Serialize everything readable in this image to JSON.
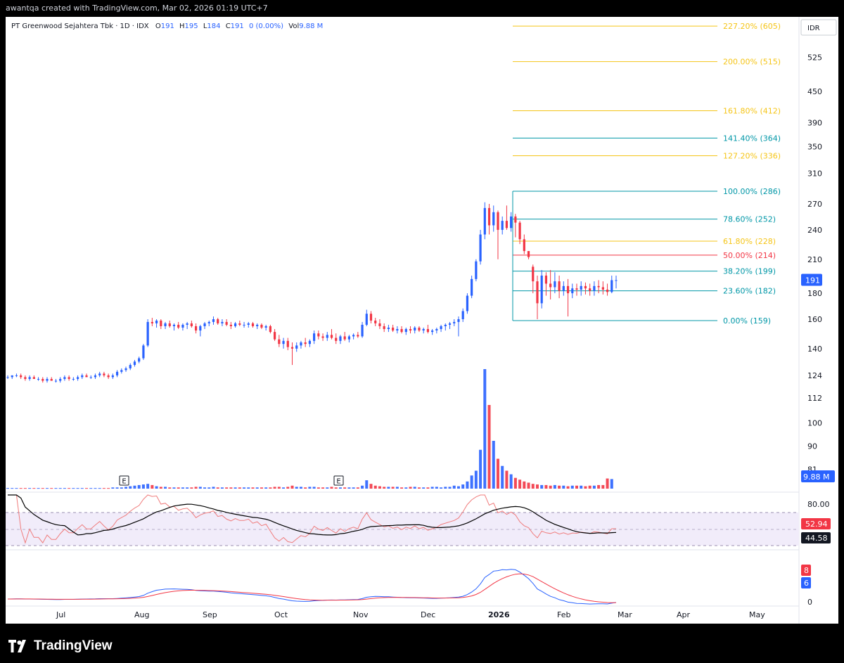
{
  "header": {
    "attribution": "awantqa created with TradingView.com, Mar 02, 2026 01:19 UTC+7"
  },
  "legend": {
    "symbol": "PT Greenwood Sejahtera Tbk · 1D · IDX",
    "open_label": "O",
    "open": "191",
    "high_label": "H",
    "high": "195",
    "low_label": "L",
    "low": "184",
    "close_label": "C",
    "close": "191",
    "change": "0 (0.00%)",
    "vol_label": "Vol",
    "vol": "9.88 M"
  },
  "footer": {
    "brand": "TradingView"
  },
  "colors": {
    "up": "#2962ff",
    "down": "#f23645",
    "fib_teal": "#26a69a",
    "fib_blue": "#0097a7",
    "fib_yellow": "#f5c518",
    "fib_red": "#f23645",
    "rsi": "#f07c7c",
    "rsi_ma": "#000000",
    "rsi_band": "#e9e0f7",
    "macd_blue": "#2962ff",
    "macd_red": "#f23645"
  },
  "chart_data": {
    "type": "candlestick",
    "title": "PT Greenwood Sejahtera Tbk · 1D · IDX",
    "currency": "IDR",
    "price_scale": "log",
    "price_axis_ticks": [
      "525",
      "450",
      "390",
      "350",
      "310",
      "270",
      "240",
      "210",
      "180",
      "160",
      "140",
      "124",
      "112",
      "100",
      "90",
      "81"
    ],
    "time_axis_ticks": [
      "Jul",
      "Aug",
      "Sep",
      "Oct",
      "Nov",
      "Dec",
      "2026",
      "Feb",
      "Mar",
      "Apr",
      "May"
    ],
    "last_price": "191",
    "last_volume": "9.88 M",
    "earnings_markers": [
      "E",
      "E"
    ],
    "fibonacci": [
      {
        "label": "227.20% (605)",
        "price": 605,
        "color": "#f5c518"
      },
      {
        "label": "200.00% (515)",
        "price": 515,
        "color": "#f5c518"
      },
      {
        "label": "161.80% (412)",
        "price": 412,
        "color": "#f5c518"
      },
      {
        "label": "141.40% (364)",
        "price": 364,
        "color": "#0097a7"
      },
      {
        "label": "127.20% (336)",
        "price": 336,
        "color": "#f5c518"
      },
      {
        "label": "100.00% (286)",
        "price": 286,
        "color": "#0097a7"
      },
      {
        "label": "78.60% (252)",
        "price": 252,
        "color": "#0097a7"
      },
      {
        "label": "61.80% (228)",
        "price": 228,
        "color": "#f5c518"
      },
      {
        "label": "50.00% (214)",
        "price": 214,
        "color": "#f23645"
      },
      {
        "label": "38.20% (199)",
        "price": 199,
        "color": "#0097a7"
      },
      {
        "label": "23.60% (182)",
        "price": 182,
        "color": "#0097a7"
      },
      {
        "label": "0.00% (159)",
        "price": 159,
        "color": "#0097a7"
      }
    ],
    "candles": [
      [
        123,
        124,
        122,
        123
      ],
      [
        123,
        124,
        122,
        124
      ],
      [
        124,
        125,
        123,
        124
      ],
      [
        124,
        125,
        122,
        123
      ],
      [
        123,
        124,
        121,
        122
      ],
      [
        122,
        124,
        121,
        123
      ],
      [
        123,
        124,
        122,
        122
      ],
      [
        122,
        123,
        121,
        122
      ],
      [
        122,
        123,
        120,
        121
      ],
      [
        121,
        123,
        120,
        122
      ],
      [
        122,
        123,
        121,
        121
      ],
      [
        121,
        122,
        120,
        121
      ],
      [
        121,
        123,
        120,
        122
      ],
      [
        122,
        124,
        121,
        123
      ],
      [
        123,
        124,
        121,
        122
      ],
      [
        122,
        123,
        121,
        122
      ],
      [
        122,
        124,
        121,
        123
      ],
      [
        123,
        125,
        122,
        124
      ],
      [
        124,
        125,
        123,
        123
      ],
      [
        123,
        124,
        122,
        123
      ],
      [
        123,
        125,
        122,
        124
      ],
      [
        124,
        126,
        123,
        125
      ],
      [
        125,
        126,
        123,
        124
      ],
      [
        124,
        125,
        122,
        123
      ],
      [
        123,
        125,
        122,
        124
      ],
      [
        124,
        127,
        123,
        126
      ],
      [
        126,
        128,
        125,
        127
      ],
      [
        127,
        129,
        126,
        128
      ],
      [
        128,
        131,
        127,
        130
      ],
      [
        130,
        133,
        129,
        132
      ],
      [
        132,
        135,
        131,
        134
      ],
      [
        134,
        143,
        133,
        142
      ],
      [
        142,
        160,
        141,
        158
      ],
      [
        158,
        161,
        155,
        157
      ],
      [
        157,
        160,
        154,
        159
      ],
      [
        159,
        160,
        153,
        155
      ],
      [
        155,
        158,
        153,
        157
      ],
      [
        157,
        159,
        154,
        155
      ],
      [
        155,
        157,
        152,
        156
      ],
      [
        156,
        158,
        153,
        154
      ],
      [
        154,
        157,
        152,
        156
      ],
      [
        156,
        158,
        153,
        157
      ],
      [
        157,
        159,
        154,
        155
      ],
      [
        155,
        157,
        150,
        152
      ],
      [
        152,
        156,
        148,
        155
      ],
      [
        155,
        158,
        153,
        157
      ],
      [
        157,
        159,
        155,
        158
      ],
      [
        158,
        162,
        156,
        160
      ],
      [
        160,
        161,
        156,
        157
      ],
      [
        157,
        160,
        155,
        158
      ],
      [
        158,
        160,
        155,
        156
      ],
      [
        156,
        158,
        153,
        155
      ],
      [
        155,
        158,
        154,
        157
      ],
      [
        157,
        159,
        155,
        156
      ],
      [
        156,
        158,
        154,
        156
      ],
      [
        156,
        158,
        154,
        157
      ],
      [
        157,
        158,
        154,
        155
      ],
      [
        155,
        157,
        153,
        156
      ],
      [
        156,
        157,
        153,
        154
      ],
      [
        154,
        156,
        152,
        155
      ],
      [
        155,
        156,
        150,
        151
      ],
      [
        151,
        153,
        145,
        146
      ],
      [
        146,
        149,
        141,
        143
      ],
      [
        143,
        147,
        140,
        145
      ],
      [
        145,
        147,
        139,
        141
      ],
      [
        141,
        144,
        130,
        140
      ],
      [
        140,
        144,
        138,
        142
      ],
      [
        142,
        145,
        140,
        144
      ],
      [
        144,
        147,
        141,
        143
      ],
      [
        143,
        146,
        141,
        145
      ],
      [
        145,
        152,
        143,
        150
      ],
      [
        150,
        152,
        146,
        148
      ],
      [
        148,
        150,
        145,
        147
      ],
      [
        147,
        151,
        145,
        149
      ],
      [
        149,
        153,
        146,
        147
      ],
      [
        147,
        150,
        143,
        145
      ],
      [
        145,
        149,
        143,
        148
      ],
      [
        148,
        151,
        145,
        146
      ],
      [
        146,
        149,
        144,
        148
      ],
      [
        148,
        150,
        146,
        149
      ],
      [
        149,
        151,
        147,
        148
      ],
      [
        148,
        158,
        147,
        156
      ],
      [
        156,
        167,
        155,
        164
      ],
      [
        164,
        166,
        157,
        159
      ],
      [
        159,
        161,
        155,
        157
      ],
      [
        157,
        160,
        153,
        155
      ],
      [
        155,
        157,
        151,
        153
      ],
      [
        153,
        156,
        151,
        154
      ],
      [
        154,
        156,
        151,
        152
      ],
      [
        152,
        155,
        150,
        153
      ],
      [
        153,
        155,
        150,
        151
      ],
      [
        151,
        154,
        149,
        153
      ],
      [
        153,
        155,
        150,
        152
      ],
      [
        152,
        155,
        150,
        154
      ],
      [
        154,
        155,
        151,
        152
      ],
      [
        152,
        154,
        150,
        153
      ],
      [
        153,
        156,
        150,
        151
      ],
      [
        151,
        153,
        149,
        152
      ],
      [
        152,
        154,
        150,
        153
      ],
      [
        153,
        156,
        151,
        155
      ],
      [
        155,
        157,
        152,
        156
      ],
      [
        156,
        158,
        153,
        157
      ],
      [
        157,
        160,
        155,
        158
      ],
      [
        158,
        162,
        148,
        160
      ],
      [
        160,
        168,
        158,
        166
      ],
      [
        166,
        180,
        164,
        178
      ],
      [
        178,
        195,
        176,
        192
      ],
      [
        192,
        210,
        190,
        208
      ],
      [
        208,
        240,
        205,
        235
      ],
      [
        235,
        272,
        230,
        265
      ],
      [
        265,
        270,
        235,
        245
      ],
      [
        245,
        268,
        238,
        260
      ],
      [
        260,
        262,
        210,
        240
      ],
      [
        240,
        255,
        235,
        250
      ],
      [
        250,
        268,
        240,
        242
      ],
      [
        242,
        260,
        238,
        255
      ],
      [
        255,
        258,
        232,
        248
      ],
      [
        248,
        250,
        225,
        230
      ],
      [
        230,
        235,
        215,
        218
      ],
      [
        218,
        210,
        212,
        212
      ],
      [
        203,
        205,
        180,
        190
      ],
      [
        190,
        195,
        160,
        172
      ],
      [
        172,
        200,
        168,
        195
      ],
      [
        195,
        198,
        178,
        188
      ],
      [
        188,
        200,
        175,
        185
      ],
      [
        185,
        198,
        180,
        190
      ],
      [
        190,
        195,
        176,
        182
      ],
      [
        182,
        190,
        178,
        186
      ],
      [
        186,
        192,
        162,
        180
      ],
      [
        180,
        188,
        176,
        184
      ],
      [
        184,
        188,
        178,
        183
      ],
      [
        183,
        190,
        178,
        186
      ],
      [
        186,
        189,
        179,
        184
      ],
      [
        184,
        188,
        178,
        182
      ],
      [
        182,
        190,
        178,
        186
      ],
      [
        186,
        191,
        180,
        185
      ],
      [
        185,
        190,
        179,
        183
      ],
      [
        183,
        188,
        178,
        181
      ],
      [
        181,
        195,
        180,
        191
      ],
      [
        191,
        195,
        184,
        191
      ]
    ],
    "volume_scale_note": "relative bar heights",
    "volumes": [
      1,
      1,
      1,
      1,
      1,
      1,
      1,
      1,
      1,
      1,
      1,
      1,
      1,
      1,
      1,
      1,
      1,
      1,
      1,
      1,
      1,
      1,
      1,
      1,
      2,
      2,
      2,
      3,
      4,
      5,
      6,
      7,
      8,
      6,
      4,
      3,
      3,
      2,
      2,
      2,
      2,
      2,
      2,
      3,
      3,
      2,
      2,
      3,
      2,
      2,
      2,
      2,
      2,
      2,
      2,
      2,
      2,
      2,
      2,
      2,
      2,
      3,
      3,
      2,
      3,
      5,
      3,
      3,
      2,
      3,
      3,
      2,
      2,
      2,
      3,
      2,
      2,
      2,
      2,
      2,
      2,
      5,
      14,
      8,
      5,
      4,
      3,
      3,
      3,
      3,
      2,
      2,
      3,
      3,
      2,
      2,
      2,
      3,
      3,
      2,
      3,
      3,
      5,
      4,
      7,
      12,
      22,
      30,
      65,
      200,
      140,
      80,
      50,
      38,
      30,
      24,
      18,
      15,
      12,
      10,
      8,
      7,
      6,
      6,
      5,
      6,
      5,
      5,
      4,
      5,
      5,
      5,
      4,
      5,
      5,
      6,
      6,
      17,
      16
    ],
    "rsi": {
      "upper": "80.00",
      "rsi_value": "52.94",
      "rsi_ma_value": "44.58",
      "upper_level": 70,
      "lower_level": 30
    },
    "macd": {
      "value_red": "8",
      "value_blue": "6",
      "zero": "0"
    }
  }
}
